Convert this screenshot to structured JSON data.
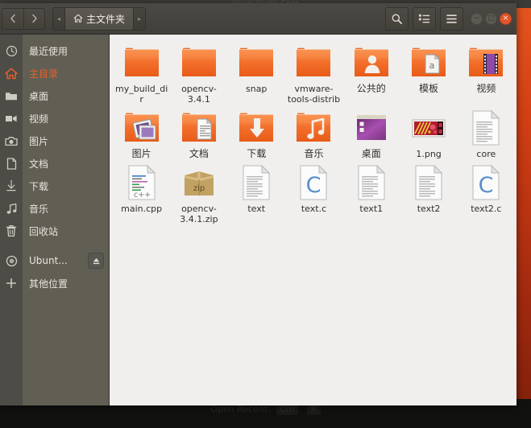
{
  "background_app": {
    "title": "Visual Studio Code",
    "bottom_text": "Open Recent",
    "bottom_kbd1": "Ctrl",
    "bottom_kbd2": "R"
  },
  "window": {
    "header": {
      "back_label": "‹",
      "forward_label": "›",
      "crumb_prev_label": "◂",
      "crumb_next_label": "▸",
      "path_label": "主文件夹",
      "home_icon": "home-icon",
      "search_icon": "search-icon",
      "view_toggle_icon": "list-view-icon",
      "menu_icon": "hamburger-menu-icon"
    },
    "controls": {
      "minimize_label": "−",
      "maximize_label": "□",
      "close_label": "×"
    }
  },
  "sidebar": {
    "items": [
      {
        "label": "最近使用",
        "icon": "clock-icon",
        "active": false,
        "eject": false
      },
      {
        "label": "主目录",
        "icon": "home-icon",
        "active": true,
        "eject": false
      },
      {
        "label": "桌面",
        "icon": "folder-icon",
        "active": false,
        "eject": false
      },
      {
        "label": "视频",
        "icon": "video-icon",
        "active": false,
        "eject": false
      },
      {
        "label": "图片",
        "icon": "camera-icon",
        "active": false,
        "eject": false
      },
      {
        "label": "文档",
        "icon": "document-icon",
        "active": false,
        "eject": false
      },
      {
        "label": "下载",
        "icon": "download-icon",
        "active": false,
        "eject": false
      },
      {
        "label": "音乐",
        "icon": "music-icon",
        "active": false,
        "eject": false
      },
      {
        "label": "回收站",
        "icon": "trash-icon",
        "active": false,
        "eject": false
      },
      {
        "label": "Ubunt...",
        "icon": "disc-icon",
        "active": false,
        "eject": true
      },
      {
        "label": "其他位置",
        "icon": "plus-icon",
        "active": false,
        "eject": false
      }
    ],
    "eject_icon": "eject-icon"
  },
  "files": [
    {
      "name": "my_build_dir",
      "type": "folder",
      "cjk": false
    },
    {
      "name": "opencv-3.4.1",
      "type": "folder",
      "cjk": false
    },
    {
      "name": "snap",
      "type": "folder",
      "cjk": false
    },
    {
      "name": "vmware-tools-distrib",
      "type": "folder",
      "cjk": false
    },
    {
      "name": "公共的",
      "type": "folder-public",
      "cjk": true
    },
    {
      "name": "模板",
      "type": "folder-templates",
      "cjk": true
    },
    {
      "name": "视频",
      "type": "folder-videos",
      "cjk": true
    },
    {
      "name": "图片",
      "type": "folder-pictures",
      "cjk": true
    },
    {
      "name": "文档",
      "type": "folder-documents",
      "cjk": true
    },
    {
      "name": "下载",
      "type": "folder-downloads",
      "cjk": true
    },
    {
      "name": "音乐",
      "type": "folder-music",
      "cjk": true
    },
    {
      "name": "桌面",
      "type": "folder-desktop",
      "cjk": true
    },
    {
      "name": "1.png",
      "type": "image-thumb",
      "cjk": false
    },
    {
      "name": "core",
      "type": "file-text",
      "cjk": false
    },
    {
      "name": "main.cpp",
      "type": "file-cpp",
      "cjk": false
    },
    {
      "name": "opencv-3.4.1.zip",
      "type": "file-zip",
      "cjk": false
    },
    {
      "name": "text",
      "type": "file-text",
      "cjk": false
    },
    {
      "name": "text.c",
      "type": "file-c",
      "cjk": false
    },
    {
      "name": "text1",
      "type": "file-text",
      "cjk": false
    },
    {
      "name": "text2",
      "type": "file-text",
      "cjk": false
    },
    {
      "name": "text2.c",
      "type": "file-c",
      "cjk": false
    }
  ],
  "colors": {
    "accent": "#e8622c",
    "folder": "#f06e29",
    "headerbar": "#46443f",
    "sidebar": "#615f54",
    "fileview": "#f0efed",
    "close_button": "#e0552b"
  }
}
